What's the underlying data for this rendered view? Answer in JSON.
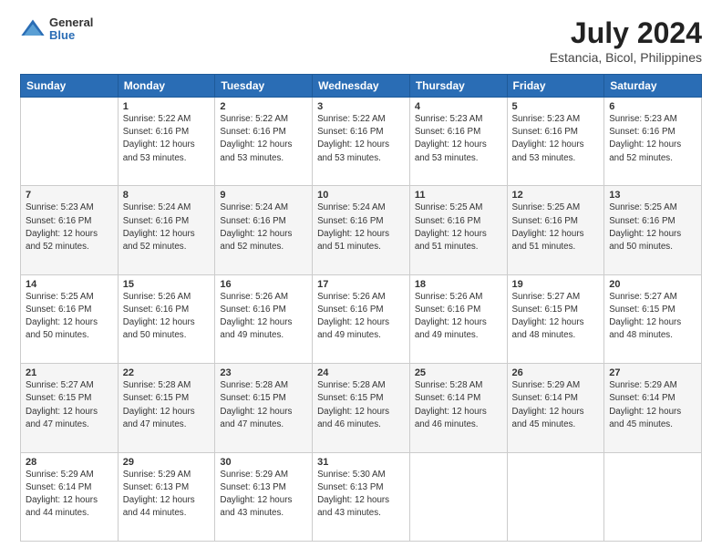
{
  "header": {
    "logo_general": "General",
    "logo_blue": "Blue",
    "title": "July 2024",
    "location": "Estancia, Bicol, Philippines"
  },
  "days_of_week": [
    "Sunday",
    "Monday",
    "Tuesday",
    "Wednesday",
    "Thursday",
    "Friday",
    "Saturday"
  ],
  "weeks": [
    [
      {
        "day": "",
        "info": ""
      },
      {
        "day": "1",
        "info": "Sunrise: 5:22 AM\nSunset: 6:16 PM\nDaylight: 12 hours\nand 53 minutes."
      },
      {
        "day": "2",
        "info": "Sunrise: 5:22 AM\nSunset: 6:16 PM\nDaylight: 12 hours\nand 53 minutes."
      },
      {
        "day": "3",
        "info": "Sunrise: 5:22 AM\nSunset: 6:16 PM\nDaylight: 12 hours\nand 53 minutes."
      },
      {
        "day": "4",
        "info": "Sunrise: 5:23 AM\nSunset: 6:16 PM\nDaylight: 12 hours\nand 53 minutes."
      },
      {
        "day": "5",
        "info": "Sunrise: 5:23 AM\nSunset: 6:16 PM\nDaylight: 12 hours\nand 53 minutes."
      },
      {
        "day": "6",
        "info": "Sunrise: 5:23 AM\nSunset: 6:16 PM\nDaylight: 12 hours\nand 52 minutes."
      }
    ],
    [
      {
        "day": "7",
        "info": "Sunrise: 5:23 AM\nSunset: 6:16 PM\nDaylight: 12 hours\nand 52 minutes."
      },
      {
        "day": "8",
        "info": "Sunrise: 5:24 AM\nSunset: 6:16 PM\nDaylight: 12 hours\nand 52 minutes."
      },
      {
        "day": "9",
        "info": "Sunrise: 5:24 AM\nSunset: 6:16 PM\nDaylight: 12 hours\nand 52 minutes."
      },
      {
        "day": "10",
        "info": "Sunrise: 5:24 AM\nSunset: 6:16 PM\nDaylight: 12 hours\nand 51 minutes."
      },
      {
        "day": "11",
        "info": "Sunrise: 5:25 AM\nSunset: 6:16 PM\nDaylight: 12 hours\nand 51 minutes."
      },
      {
        "day": "12",
        "info": "Sunrise: 5:25 AM\nSunset: 6:16 PM\nDaylight: 12 hours\nand 51 minutes."
      },
      {
        "day": "13",
        "info": "Sunrise: 5:25 AM\nSunset: 6:16 PM\nDaylight: 12 hours\nand 50 minutes."
      }
    ],
    [
      {
        "day": "14",
        "info": "Sunrise: 5:25 AM\nSunset: 6:16 PM\nDaylight: 12 hours\nand 50 minutes."
      },
      {
        "day": "15",
        "info": "Sunrise: 5:26 AM\nSunset: 6:16 PM\nDaylight: 12 hours\nand 50 minutes."
      },
      {
        "day": "16",
        "info": "Sunrise: 5:26 AM\nSunset: 6:16 PM\nDaylight: 12 hours\nand 49 minutes."
      },
      {
        "day": "17",
        "info": "Sunrise: 5:26 AM\nSunset: 6:16 PM\nDaylight: 12 hours\nand 49 minutes."
      },
      {
        "day": "18",
        "info": "Sunrise: 5:26 AM\nSunset: 6:16 PM\nDaylight: 12 hours\nand 49 minutes."
      },
      {
        "day": "19",
        "info": "Sunrise: 5:27 AM\nSunset: 6:15 PM\nDaylight: 12 hours\nand 48 minutes."
      },
      {
        "day": "20",
        "info": "Sunrise: 5:27 AM\nSunset: 6:15 PM\nDaylight: 12 hours\nand 48 minutes."
      }
    ],
    [
      {
        "day": "21",
        "info": "Sunrise: 5:27 AM\nSunset: 6:15 PM\nDaylight: 12 hours\nand 47 minutes."
      },
      {
        "day": "22",
        "info": "Sunrise: 5:28 AM\nSunset: 6:15 PM\nDaylight: 12 hours\nand 47 minutes."
      },
      {
        "day": "23",
        "info": "Sunrise: 5:28 AM\nSunset: 6:15 PM\nDaylight: 12 hours\nand 47 minutes."
      },
      {
        "day": "24",
        "info": "Sunrise: 5:28 AM\nSunset: 6:15 PM\nDaylight: 12 hours\nand 46 minutes."
      },
      {
        "day": "25",
        "info": "Sunrise: 5:28 AM\nSunset: 6:14 PM\nDaylight: 12 hours\nand 46 minutes."
      },
      {
        "day": "26",
        "info": "Sunrise: 5:29 AM\nSunset: 6:14 PM\nDaylight: 12 hours\nand 45 minutes."
      },
      {
        "day": "27",
        "info": "Sunrise: 5:29 AM\nSunset: 6:14 PM\nDaylight: 12 hours\nand 45 minutes."
      }
    ],
    [
      {
        "day": "28",
        "info": "Sunrise: 5:29 AM\nSunset: 6:14 PM\nDaylight: 12 hours\nand 44 minutes."
      },
      {
        "day": "29",
        "info": "Sunrise: 5:29 AM\nSunset: 6:13 PM\nDaylight: 12 hours\nand 44 minutes."
      },
      {
        "day": "30",
        "info": "Sunrise: 5:29 AM\nSunset: 6:13 PM\nDaylight: 12 hours\nand 43 minutes."
      },
      {
        "day": "31",
        "info": "Sunrise: 5:30 AM\nSunset: 6:13 PM\nDaylight: 12 hours\nand 43 minutes."
      },
      {
        "day": "",
        "info": ""
      },
      {
        "day": "",
        "info": ""
      },
      {
        "day": "",
        "info": ""
      }
    ]
  ]
}
